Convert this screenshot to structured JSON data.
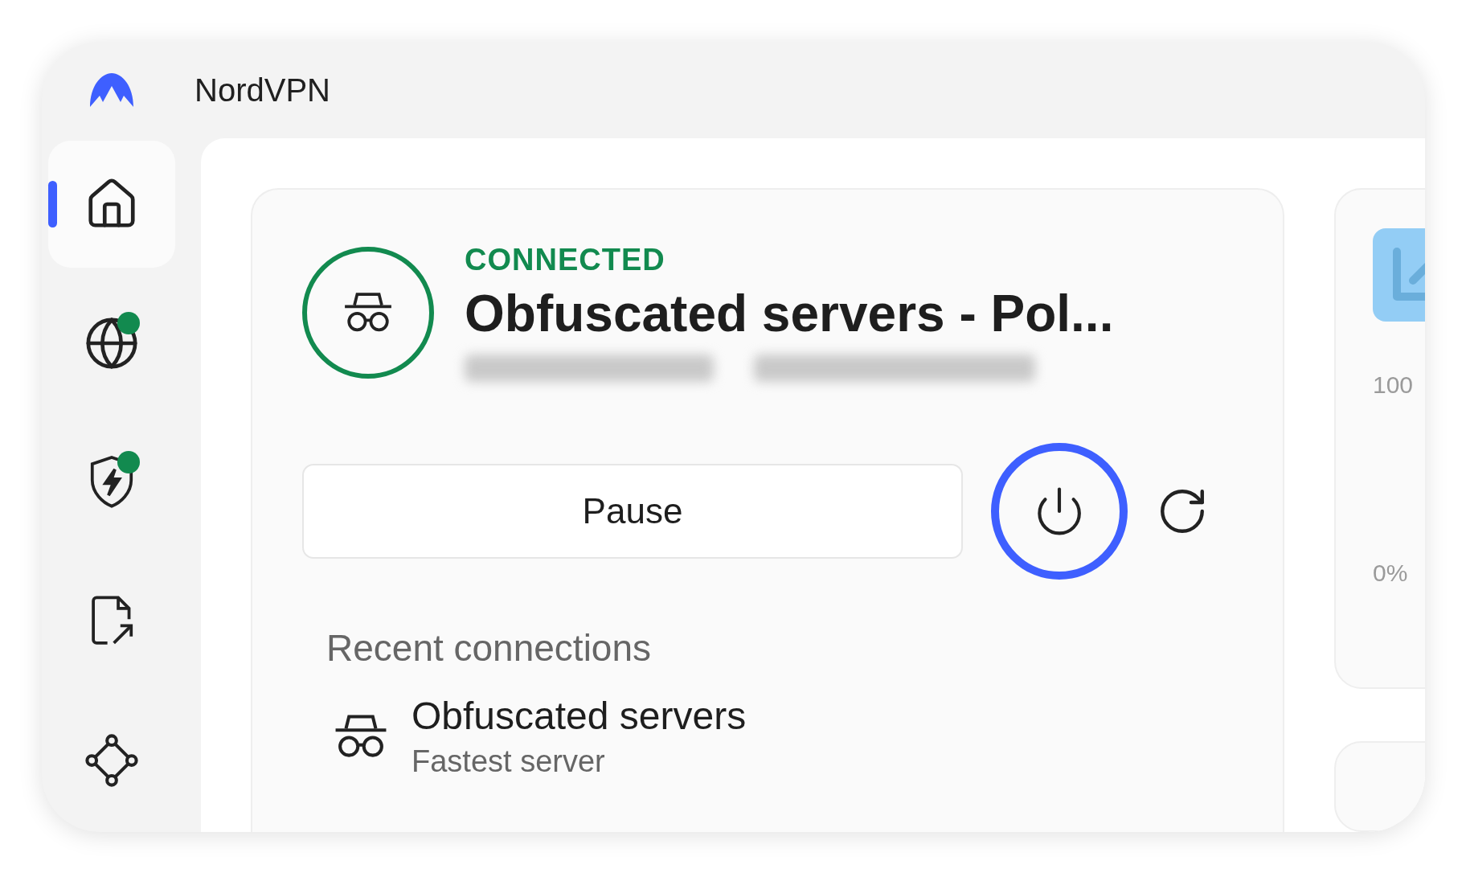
{
  "app": {
    "title": "NordVPN"
  },
  "sidebar": {
    "items": [
      {
        "kind": "home",
        "selected": true,
        "badge": false
      },
      {
        "kind": "globe",
        "selected": false,
        "badge": true
      },
      {
        "kind": "shield",
        "selected": false,
        "badge": true
      },
      {
        "kind": "file-share",
        "selected": false,
        "badge": false
      },
      {
        "kind": "mesh",
        "selected": false,
        "badge": false
      }
    ]
  },
  "status": {
    "label": "CONNECTED",
    "server": "Obfuscated servers - Pol..."
  },
  "actions": {
    "pause": "Pause"
  },
  "recent": {
    "heading": "Recent connections",
    "items": [
      {
        "name": "Obfuscated servers",
        "detail": "Fastest server"
      }
    ]
  },
  "stats_panel": {
    "max_label": "100",
    "min_label": "0%"
  }
}
